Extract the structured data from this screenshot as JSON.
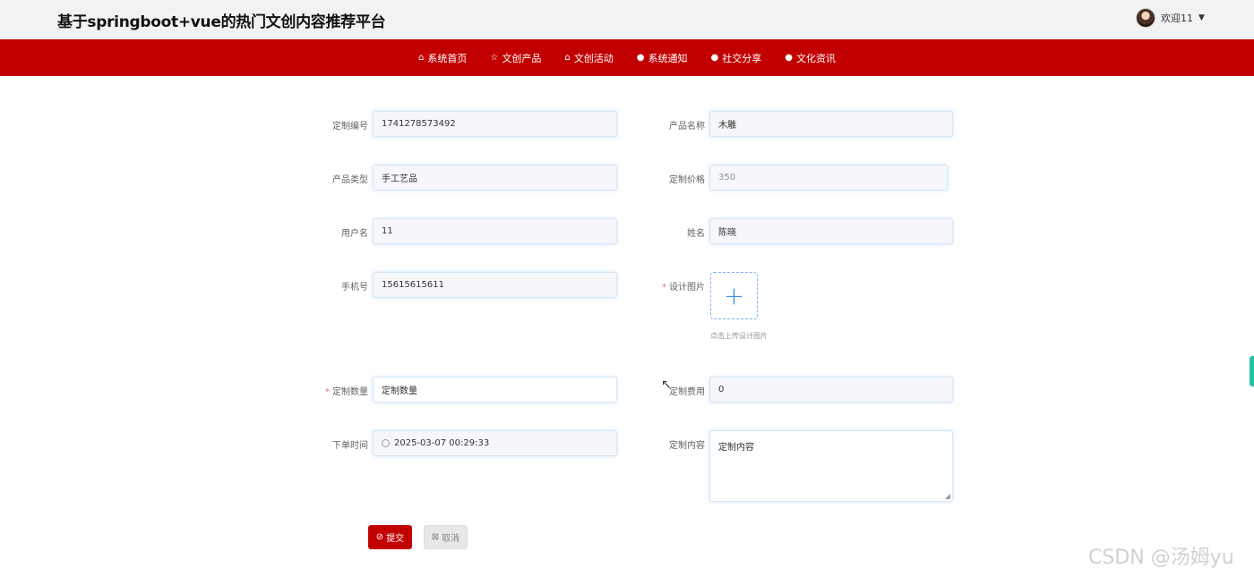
{
  "header": {
    "site_title": "基于springboot+vue的热门文创内容推荐平台",
    "user_greeting": "欢迎11"
  },
  "nav": [
    {
      "icon": "home-icon",
      "glyph": "⌂",
      "label": "系统首页"
    },
    {
      "icon": "star-icon",
      "glyph": "☆",
      "label": "文创产品"
    },
    {
      "icon": "bag-icon",
      "glyph": "⌂",
      "label": "文创活动"
    },
    {
      "icon": "info-icon",
      "glyph": "●",
      "label": "系统通知"
    },
    {
      "icon": "info-icon",
      "glyph": "●",
      "label": "社交分享"
    },
    {
      "icon": "check-icon",
      "glyph": "●",
      "label": "文化资讯"
    }
  ],
  "form": {
    "custom_no": {
      "label": "定制编号",
      "value": "1741278573492"
    },
    "product_name": {
      "label": "产品名称",
      "value": "木雕"
    },
    "product_type": {
      "label": "产品类型",
      "value": "手工艺品"
    },
    "custom_price": {
      "label": "定制价格",
      "value": "350"
    },
    "username": {
      "label": "用户名",
      "value": "11"
    },
    "name": {
      "label": "姓名",
      "value": "陈晓"
    },
    "phone": {
      "label": "手机号",
      "value": "15615615611"
    },
    "design_image": {
      "label": "设计图片",
      "tip": "点击上传设计图片"
    },
    "quantity": {
      "label": "定制数量",
      "placeholder": "定制数量"
    },
    "fee": {
      "label": "定制费用",
      "value": "0"
    },
    "order_time": {
      "label": "下单时间",
      "value": "2025-03-07 00:29:33"
    },
    "content": {
      "label": "定制内容",
      "placeholder": "定制内容"
    }
  },
  "buttons": {
    "submit": "提交",
    "cancel": "取消"
  },
  "watermark": "CSDN @汤姆yu",
  "colors": {
    "brand": "#c20000",
    "required": "#f56c6c",
    "upload_accent": "#3d8ee6"
  }
}
